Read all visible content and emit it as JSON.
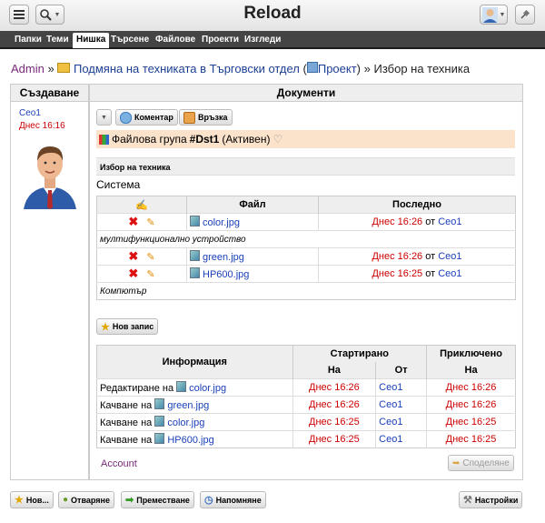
{
  "header": {
    "title": "Reload"
  },
  "tabs": [
    "Папки",
    "Теми",
    "Нишка",
    "Търсене",
    "Файлове",
    "Проекти",
    "Изгледи"
  ],
  "active_tab": "Нишка",
  "breadcrumb": {
    "root": "Admin",
    "sep": "»",
    "thread": "Подмяна на техниката в Търговски отдел",
    "project": "Проект",
    "current": "Избор на техника"
  },
  "left": {
    "title": "Създаване",
    "user": "Ceo1",
    "time": "Днес 16:16"
  },
  "docs": {
    "title": "Документи",
    "buttons": {
      "comment": "Коментар",
      "link": "Връзка"
    },
    "group": {
      "prefix": "Файлова група",
      "name": "#Dst1",
      "status": "(Активен)"
    },
    "section": "Избор на техника",
    "category": "Система",
    "table_headers": {
      "file": "Файл",
      "last": "Последно"
    },
    "rows": [
      {
        "file": "color.jpg",
        "time": "Днес 16:26",
        "by": "от",
        "user": "Ceo1"
      },
      {
        "group": "мултифункционално устройство"
      },
      {
        "file": "green.jpg",
        "time": "Днес 16:26",
        "by": "от",
        "user": "Ceo1"
      },
      {
        "file": "HP600.jpg",
        "time": "Днес 16:25",
        "by": "от",
        "user": "Ceo1"
      },
      {
        "group": "Компютър"
      }
    ],
    "new_entry": "Нов запис",
    "info": {
      "headers": {
        "info": "Информация",
        "started": "Стартирано",
        "finished": "Приключено",
        "on": "На",
        "from": "От",
        "on2": "На"
      },
      "rows": [
        {
          "action": "Редактиране на",
          "file": "color.jpg",
          "started": "Днес 16:26",
          "user": "Ceo1",
          "finished": "Днес 16:26"
        },
        {
          "action": "Качване на",
          "file": "green.jpg",
          "started": "Днес 16:26",
          "user": "Ceo1",
          "finished": "Днес 16:26"
        },
        {
          "action": "Качване на",
          "file": "color.jpg",
          "started": "Днес 16:25",
          "user": "Ceo1",
          "finished": "Днес 16:25"
        },
        {
          "action": "Качване на",
          "file": "HP600.jpg",
          "started": "Днес 16:25",
          "user": "Ceo1",
          "finished": "Днес 16:25"
        }
      ]
    },
    "account": "Account",
    "share": "Споделяне"
  },
  "footer": {
    "new": "Нов...",
    "open": "Отваряне",
    "move": "Преместване",
    "remind": "Напомняне",
    "settings": "Настройки"
  },
  "colors": {
    "accent": "#1c3f94",
    "red": "#cc0000",
    "navbar": "#444444",
    "group_bg": "#fbe3cb"
  }
}
